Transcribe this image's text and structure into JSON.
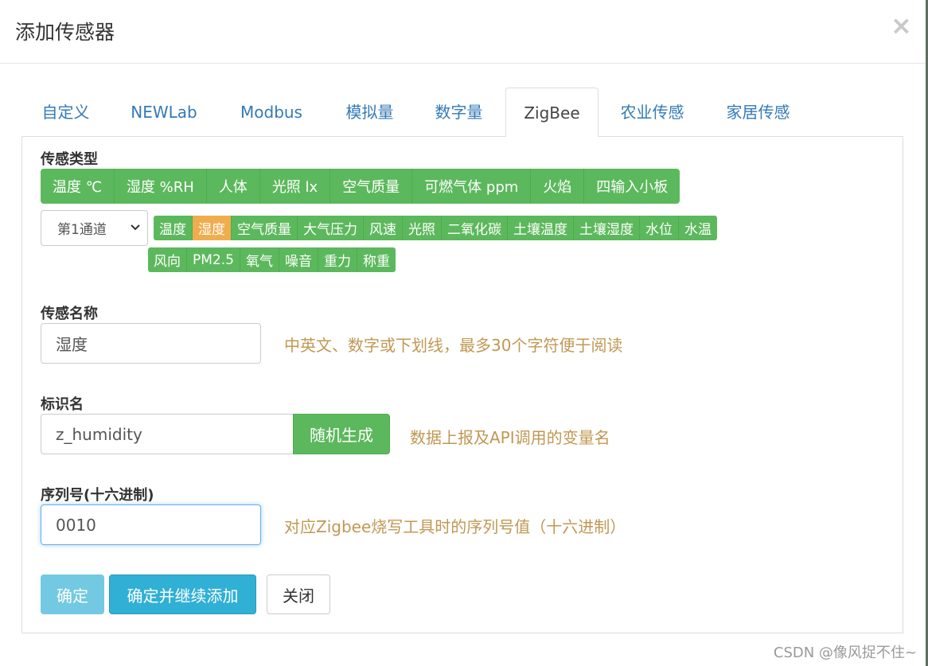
{
  "modal": {
    "title": "添加传感器",
    "close": "×"
  },
  "tabs": [
    {
      "label": "自定义"
    },
    {
      "label": "NEWLab"
    },
    {
      "label": "Modbus"
    },
    {
      "label": "模拟量"
    },
    {
      "label": "数字量"
    },
    {
      "label": "ZigBee",
      "active": true
    },
    {
      "label": "农业传感"
    },
    {
      "label": "家居传感"
    }
  ],
  "sensor_type": {
    "label": "传感类型",
    "types": [
      "温度 ℃",
      "湿度 %RH",
      "人体",
      "光照 lx",
      "空气质量",
      "可燃气体 ppm",
      "火焰",
      "四输入小板"
    ],
    "channel_select": "第1通道",
    "channel_types_row1": [
      "温度",
      "湿度",
      "空气质量",
      "大气压力",
      "风速",
      "光照",
      "二氧化碳",
      "土壤温度",
      "土壤湿度",
      "水位",
      "水温"
    ],
    "channel_types_row2": [
      "风向",
      "PM2.5",
      "氧气",
      "噪音",
      "重力",
      "称重"
    ],
    "selected_channel_type": "湿度"
  },
  "sensor_name": {
    "label": "传感名称",
    "value": "湿度",
    "hint": "中英文、数字或下划线，最多30个字符便于阅读"
  },
  "identifier": {
    "label": "标识名",
    "value": "z_humidity",
    "button": "随机生成",
    "hint": "数据上报及API调用的变量名"
  },
  "serial": {
    "label": "序列号(十六进制)",
    "value": "0010",
    "hint": "对应Zigbee烧写工具时的序列号值（十六进制）"
  },
  "footer": {
    "ok": "确定",
    "ok_continue": "确定并继续添加",
    "close": "关闭"
  },
  "watermark": "CSDN @像风捉不住~",
  "colors": {
    "green": "#5cb85c",
    "orange": "#f0ad4e",
    "info": "#5bc0de",
    "hint": "#c09853",
    "link": "#337ab7"
  }
}
